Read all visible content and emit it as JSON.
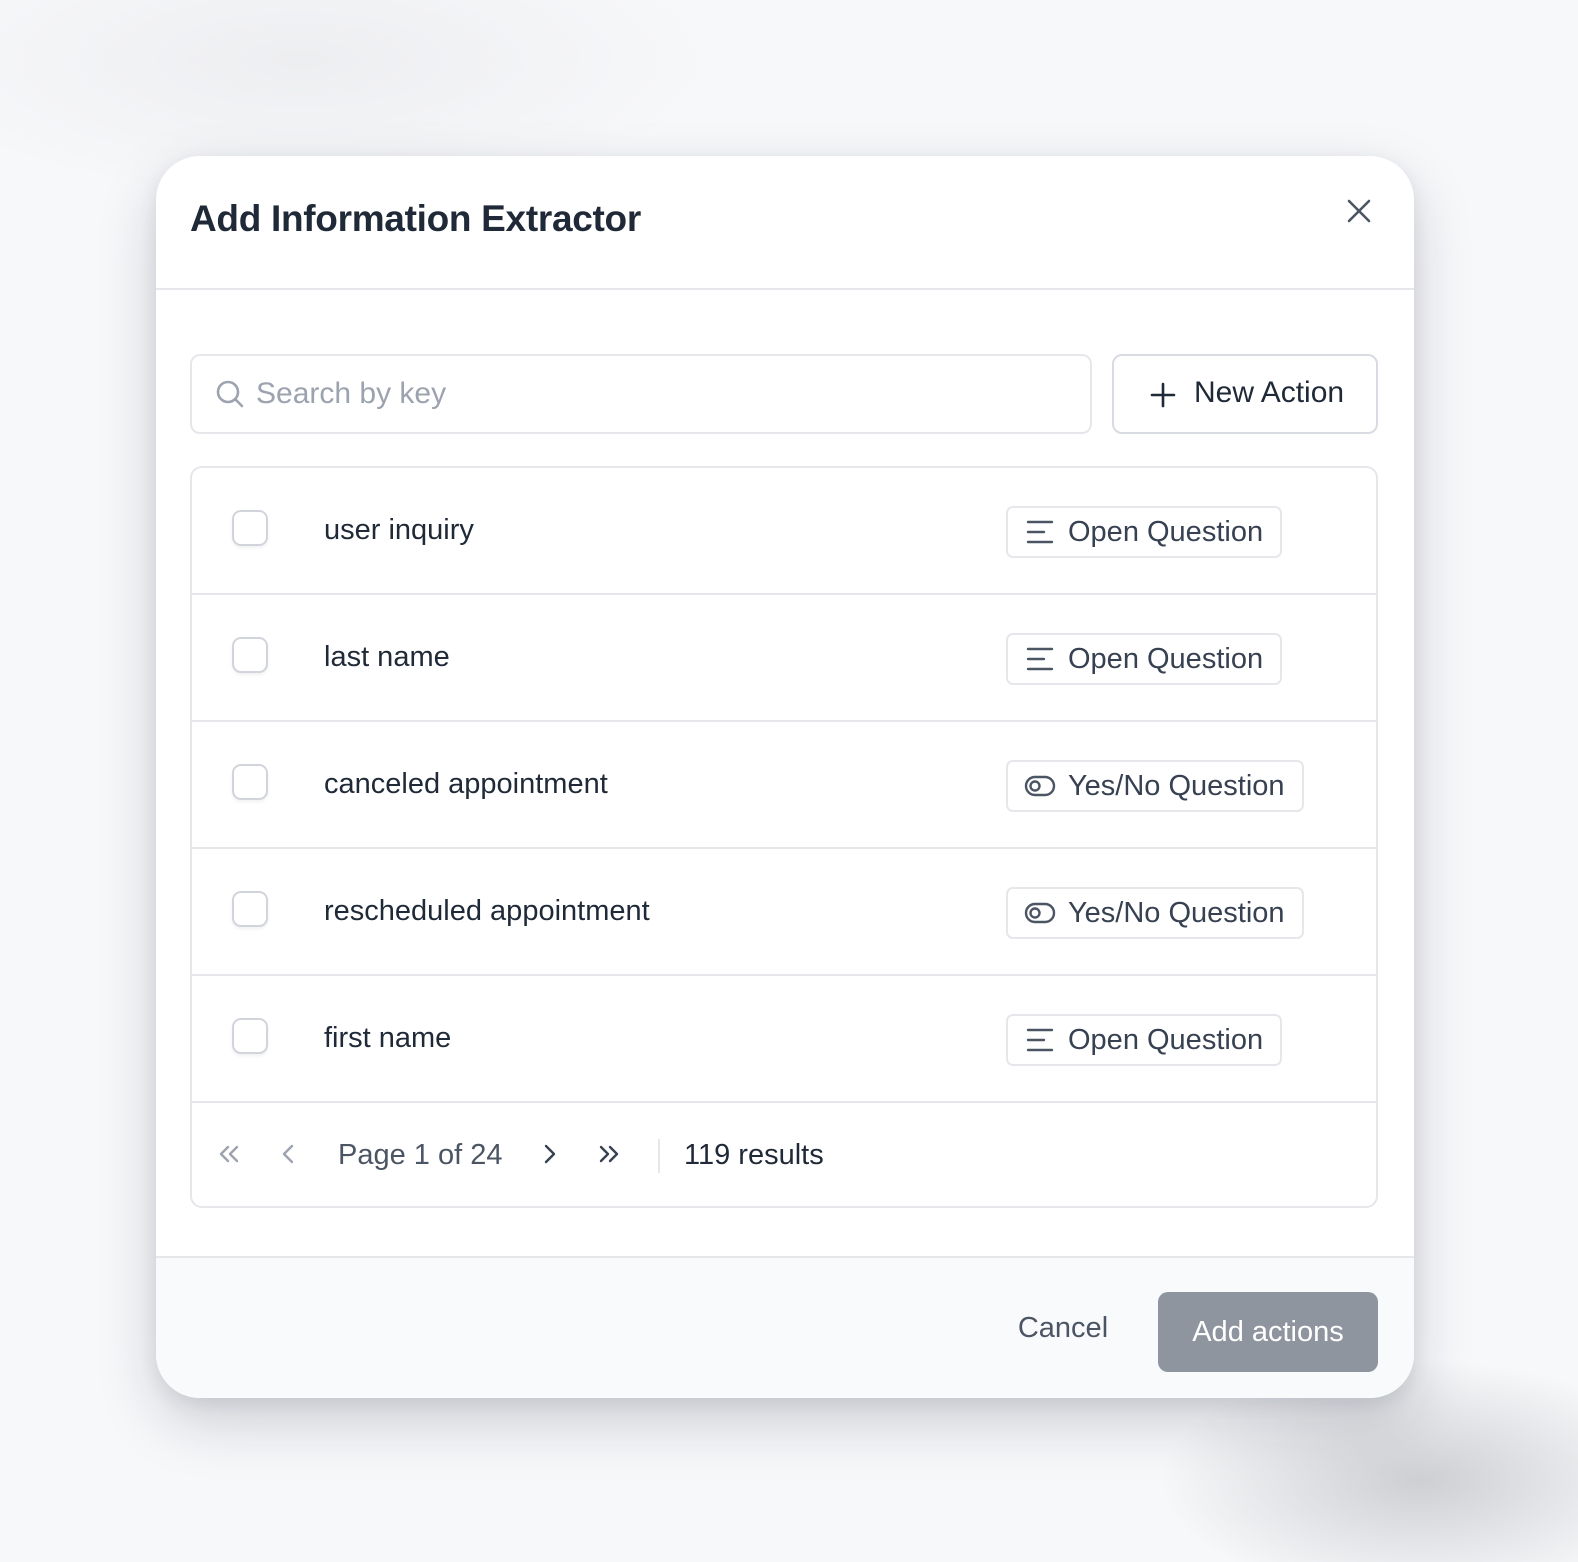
{
  "modal": {
    "title": "Add Information Extractor",
    "close_icon": "close-icon"
  },
  "search": {
    "placeholder": "Search by key",
    "value": "",
    "icon": "search-icon"
  },
  "new_action": {
    "label": "New Action",
    "icon": "plus-icon"
  },
  "rows": [
    {
      "label": "user inquiry",
      "checked": false,
      "type_label": "Open Question",
      "type_icon": "lines-icon"
    },
    {
      "label": "last name",
      "checked": false,
      "type_label": "Open Question",
      "type_icon": "lines-icon"
    },
    {
      "label": "canceled appointment",
      "checked": false,
      "type_label": "Yes/No Question",
      "type_icon": "toggle-icon"
    },
    {
      "label": "rescheduled appointment",
      "checked": false,
      "type_label": "Yes/No Question",
      "type_icon": "toggle-icon"
    },
    {
      "label": "first name",
      "checked": false,
      "type_label": "Open Question",
      "type_icon": "lines-icon"
    }
  ],
  "pagination": {
    "page_text": "Page 1 of 24",
    "results_text": "119 results",
    "first_icon": "chevrons-left-icon",
    "prev_icon": "chevron-left-icon",
    "next_icon": "chevron-right-icon",
    "last_icon": "chevrons-right-icon"
  },
  "footer": {
    "cancel_label": "Cancel",
    "add_label": "Add actions"
  },
  "colors": {
    "primary_button": "#8f959e",
    "border": "#e5e7eb",
    "text": "#1f2937",
    "muted_text": "#9ca3af"
  }
}
